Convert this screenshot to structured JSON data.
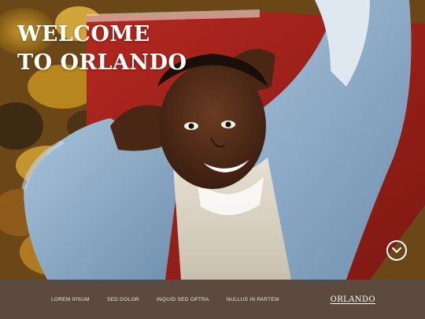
{
  "hero": {
    "headline_line1": "WELCOME",
    "headline_line2": "TO ORLANDO",
    "scroll_icon": "chevron-down-circle-icon"
  },
  "nav": {
    "items": [
      {
        "label": "LOREM IPSUM"
      },
      {
        "label": "SED DOLOR"
      },
      {
        "label": "INQUID SED OPTRA"
      },
      {
        "label": "NULLUS IN PARTEM"
      }
    ],
    "brand": "ORLANDO"
  },
  "colors": {
    "navbar_bg": "#5b4a3d",
    "headline": "#ffffff",
    "nav_text": "#f0e8e0"
  }
}
